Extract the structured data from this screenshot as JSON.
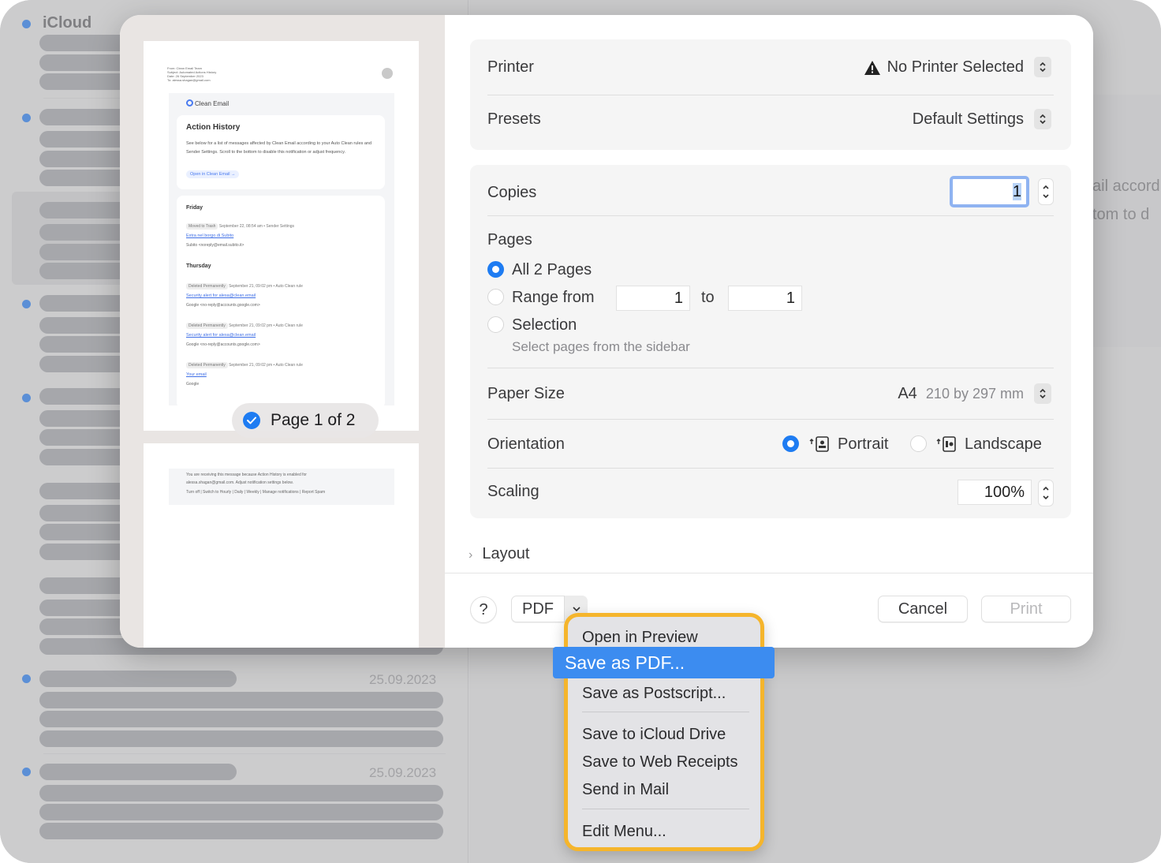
{
  "background": {
    "account_label": "iCloud",
    "dates": [
      "25.09.2023",
      "25.09.2023"
    ],
    "snippet_lines": [
      "ail accord",
      "tom to d"
    ]
  },
  "preview": {
    "email_header_lines": [
      "From: Clean Email Team",
      "Subject: Automated Actions History",
      "Date: 26 September 2023",
      "To: alessa.shagan@gmail.com"
    ],
    "brand": "Clean Email",
    "card_title": "Action History",
    "card_text": "See below for a list of messages affected by Clean Email according to your Auto Clean rules and Sender Settings. Scroll to the bottom to disable this notification or adjust frequency.",
    "open_button": "Open in Clean Email →",
    "days": [
      "Friday",
      "Thursday"
    ],
    "entries": [
      {
        "tag": "Moved to Trash",
        "meta": "September 22, 08:54 am • Sender Settings",
        "subject": "Extra nel borgo di Subito",
        "sender": "Subito <noreply@email.subito.it>"
      },
      {
        "tag": "Deleted Permanently",
        "meta": "September 21, 09:02 pm • Auto Clean rule",
        "subject": "Security alert for alesa@clean.email",
        "sender": "Google <no-reply@accounts.google.com>"
      },
      {
        "tag": "Deleted Permanently",
        "meta": "September 21, 09:02 pm • Auto Clean rule",
        "subject": "Security alert for alesa@clean.email",
        "sender": "Google <no-reply@accounts.google.com>"
      },
      {
        "tag": "Deleted Permanently",
        "meta": "September 21, 09:02 pm • Auto Clean rule",
        "subject": "Your email",
        "sender": "Google"
      }
    ],
    "page_indicator": "Page 1 of 2",
    "footer_lines": [
      "You are receiving this message because Action History is enabled for",
      "alessa.shagan@gmail.com. Adjust notification settings below.",
      "Turn off | Switch to Hourly | Daily | Weekly | Manage notifications | Report Spam"
    ]
  },
  "settings": {
    "printer": {
      "label": "Printer",
      "value": "No Printer Selected"
    },
    "presets": {
      "label": "Presets",
      "value": "Default Settings"
    },
    "copies": {
      "label": "Copies",
      "value": "1"
    },
    "pages": {
      "label": "Pages",
      "all_option": "All 2 Pages",
      "range_option": "Range from",
      "range_from": "1",
      "range_to_label": "to",
      "range_to": "1",
      "selection_option": "Selection",
      "selection_hint": "Select pages from the sidebar",
      "selected": "all"
    },
    "paper_size": {
      "label": "Paper Size",
      "value": "A4",
      "detail": "210 by 297 mm"
    },
    "orientation": {
      "label": "Orientation",
      "portrait": "Portrait",
      "landscape": "Landscape",
      "selected": "portrait"
    },
    "scaling": {
      "label": "Scaling",
      "value": "100%"
    },
    "layout": "Layout"
  },
  "footer": {
    "help": "?",
    "pdf": "PDF",
    "cancel": "Cancel",
    "print": "Print"
  },
  "pdf_menu": {
    "items": [
      "Open in Preview",
      "Save as PDF...",
      "Save as Postscript...",
      "Save to iCloud Drive",
      "Save to Web Receipts",
      "Send in Mail",
      "Edit Menu..."
    ],
    "highlighted": "Save as PDF..."
  },
  "colors": {
    "accent": "#1e7cf2",
    "menu_highlight": "#3c8cf0",
    "callout_border": "#f5b52c"
  }
}
